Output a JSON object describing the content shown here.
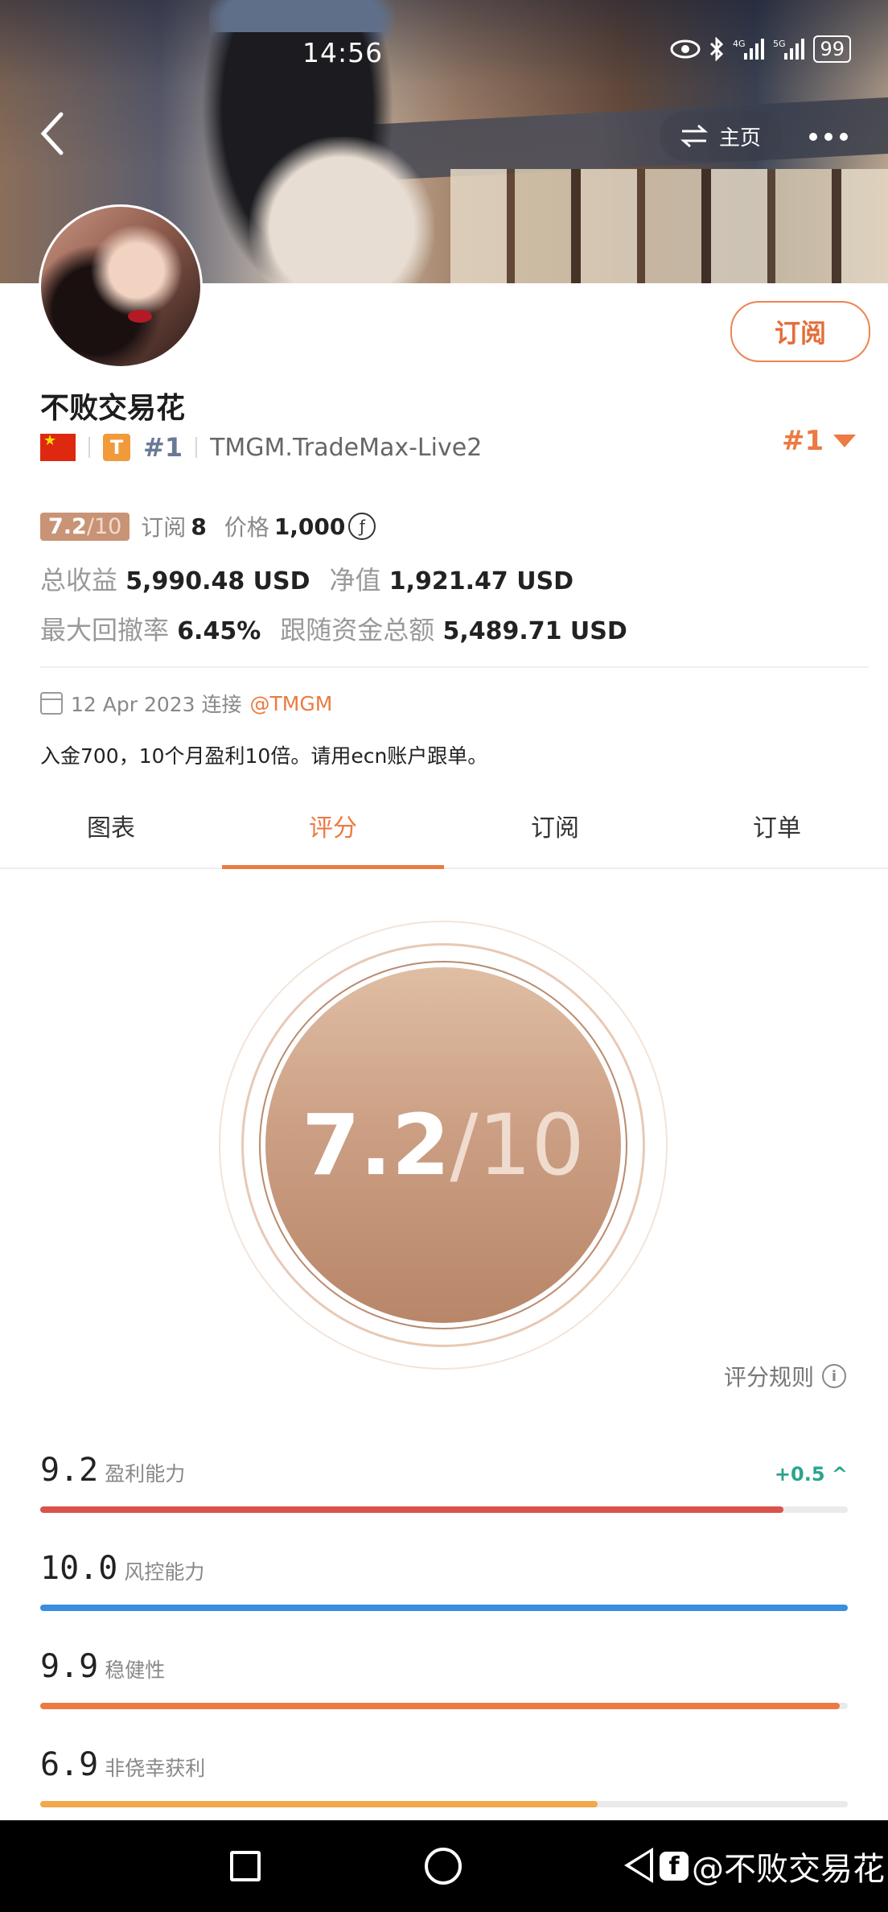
{
  "status_bar": {
    "time": "14:56",
    "battery": "99"
  },
  "header": {
    "home_label": "主页"
  },
  "profile": {
    "name": "不败交易花",
    "rank": "#1",
    "broker": "TMGM.TradeMax-Live2",
    "rank_right": "#1",
    "subscribe_label": "订阅"
  },
  "stats": {
    "score_num": "7.2",
    "score_den": "/10",
    "subs_label": "订阅",
    "subs_value": "8",
    "price_label": "价格",
    "price_value": "1,000",
    "total_profit_label": "总收益",
    "total_profit_value": "5,990.48 USD",
    "equity_label": "净值",
    "equity_value": "1,921.47 USD",
    "max_dd_label": "最大回撤率",
    "max_dd_value": "6.45%",
    "follow_funds_label": "跟随资金总额",
    "follow_funds_value": "5,489.71 USD"
  },
  "connect": {
    "date_text": "12 Apr 2023 连接",
    "handle": "@TMGM"
  },
  "bio": "入金700，10个月盈利10倍。请用ecn账户跟单。",
  "tabs": [
    {
      "label": "图表"
    },
    {
      "label": "评分"
    },
    {
      "label": "订阅"
    },
    {
      "label": "订单"
    }
  ],
  "score": {
    "value": "7.2",
    "denominator": "/10",
    "rules_label": "评分规则"
  },
  "score_rows": [
    {
      "value": "9.2",
      "label": "盈利能力",
      "delta": "+0.5 ^",
      "fraction": 0.92,
      "color": "#d9534a"
    },
    {
      "value": "10.0",
      "label": "风控能力",
      "fraction": 1.0,
      "color": "#3a8ee0"
    },
    {
      "value": "9.9",
      "label": "稳健性",
      "fraction": 0.99,
      "color": "#ec7a42"
    },
    {
      "value": "6.9",
      "label": "非侥幸获利",
      "fraction": 0.69,
      "color": "#f0a94b"
    }
  ],
  "watermark": "@不败交易花"
}
